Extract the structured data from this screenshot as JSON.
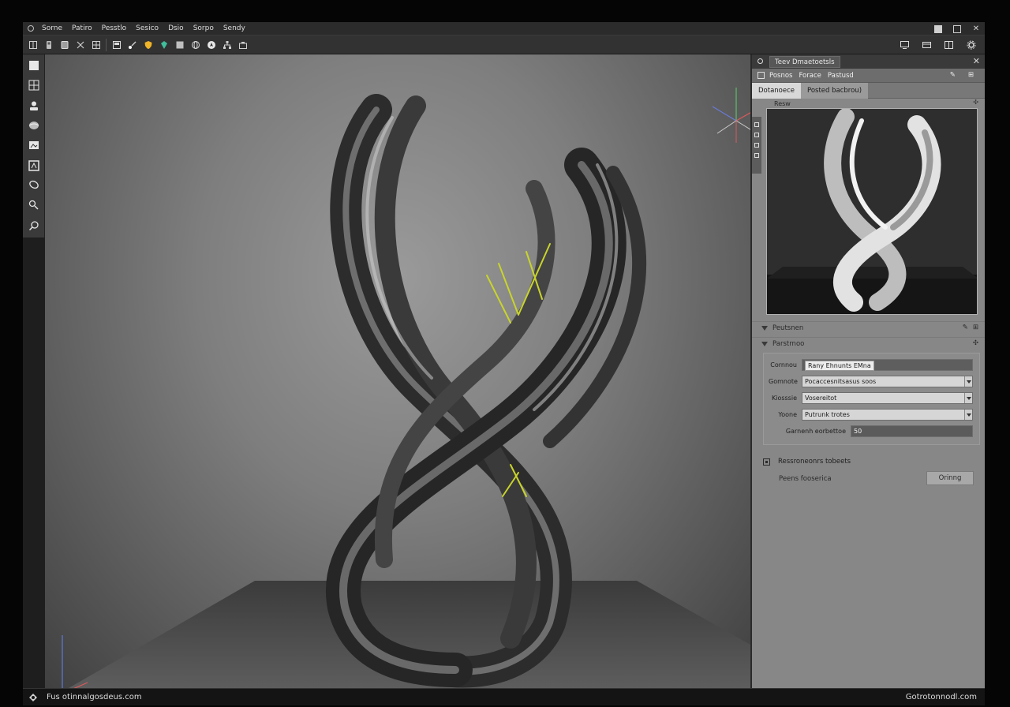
{
  "menu": [
    "Sorne",
    "Patiro",
    "Pesstlo",
    "Sesico",
    "Dsio",
    "Sorpo",
    "Sendy"
  ],
  "panel": {
    "tab_title": "Teev Dmaetoetsls",
    "subtabs": [
      "Posnos",
      "Forace",
      "Pastusd"
    ],
    "tabs": [
      {
        "label": "Dotanoece",
        "active": true
      },
      {
        "label": "Posted bacbrou)",
        "active": false
      }
    ],
    "preview_label": "Resw",
    "section_1": "Peutsnen",
    "section_2": "Parstrnoo",
    "params": [
      {
        "label": "Cornnou",
        "value": "Rany Ehnunts EMna",
        "type": "text"
      },
      {
        "label": "Gomnote",
        "value": "Pocaccesnitsasus soos",
        "type": "select"
      },
      {
        "label": "Kiosssie",
        "value": "Vosereitot",
        "type": "select"
      },
      {
        "label": "Yoone",
        "value": "Putrunk trotes",
        "type": "select"
      }
    ],
    "number_param": {
      "label": "Garnenh eorbettoe",
      "value": "50"
    },
    "checkbox_label": "Ressroneonrs tobeets",
    "action_label": "Peens fooserica",
    "action_button": "Orinng"
  },
  "status": {
    "left": "Fus otinnalgosdeus.com",
    "right": "Gotrotonnodl.com"
  },
  "icons": {
    "toolbar": [
      "new-doc-icon",
      "save-icon",
      "layers-icon",
      "cut-icon",
      "grid-icon",
      "panel-icon",
      "paint-icon",
      "shield-icon",
      "gem-icon",
      "square-icon",
      "globe-icon",
      "navigate-icon",
      "hierarchy-icon",
      "camera-icon"
    ],
    "palette": [
      "file-icon",
      "transform-icon",
      "user-icon",
      "sphere-icon",
      "image-icon",
      "frame-icon",
      "lasso-icon",
      "paint-tool-icon",
      "search-tool-icon"
    ]
  }
}
